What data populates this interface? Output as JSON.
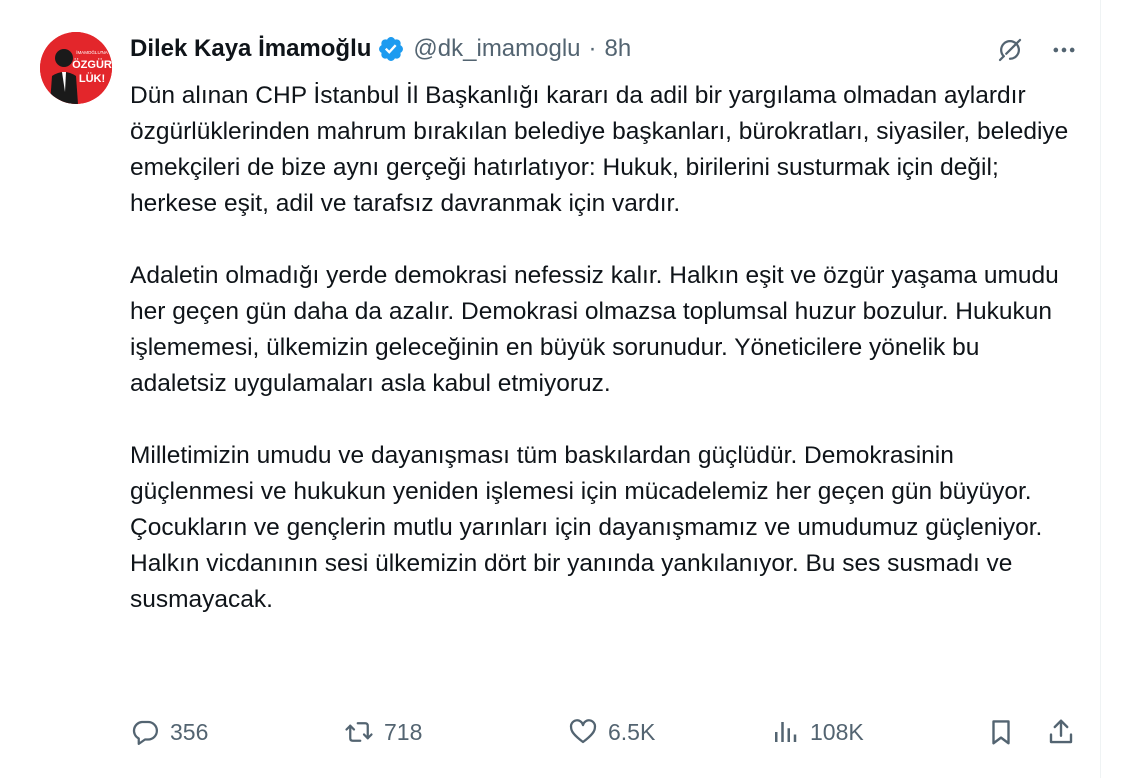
{
  "tweet": {
    "author": {
      "display_name": "Dilek Kaya İmamoğlu",
      "handle": "@dk_imamoglu",
      "separator": "·",
      "time": "8h",
      "avatar_text_top": "İMAMOĞLU'NA",
      "avatar_text_main": "ÖZGÜR",
      "avatar_text_bottom": "LÜK!",
      "verified": true,
      "verified_color": "#1d9bf0",
      "avatar_color": "#e3262b"
    },
    "paragraphs": [
      "Dün alınan CHP İstanbul İl Başkanlığı kararı da adil bir yargılama olmadan aylardır özgürlüklerinden mahrum bırakılan belediye başkanları, bürokratları, siyasiler, belediye emekçileri de bize aynı gerçeği hatırlatıyor: Hukuk, birilerini susturmak için değil; herkese eşit, adil ve tarafsız davranmak için vardır.",
      "Adaletin olmadığı yerde demokrasi nefessiz kalır. Halkın eşit ve özgür yaşama umudu her geçen gün daha da azalır. Demokrasi olmazsa toplumsal huzur bozulur. Hukukun işlememesi, ülkemizin geleceğinin en büyük sorunudur. Yöneticilere yönelik bu adaletsiz uygulamaları asla kabul etmiyoruz.",
      "Milletimizin umudu ve dayanışması tüm baskılardan güçlüdür. Demokrasinin güçlenmesi ve hukukun yeniden işlemesi için mücadelemiz her geçen gün büyüyor. Çocukların ve gençlerin mutlu yarınları için dayanışmamız ve umudumuz güçleniyor. Halkın vicdanının sesi ülkemizin dört bir yanında yankılanıyor. Bu ses susmadı ve susmayacak."
    ],
    "actions": {
      "replies": "356",
      "reposts": "718",
      "likes": "6.5K",
      "views": "108K"
    },
    "icons": {
      "grok": "grok-icon",
      "more": "more-icon",
      "reply": "reply-icon",
      "repost": "repost-icon",
      "like": "heart-icon",
      "views": "views-icon",
      "bookmark": "bookmark-icon",
      "share": "share-icon"
    }
  }
}
